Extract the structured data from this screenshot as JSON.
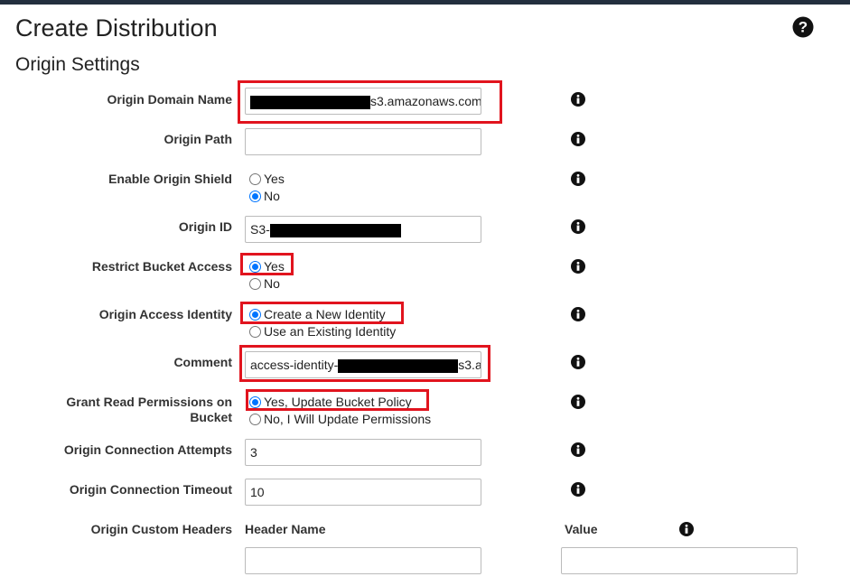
{
  "page": {
    "title": "Create Distribution",
    "section_title": "Origin Settings"
  },
  "fields": {
    "origin_domain_name": {
      "label": "Origin Domain Name",
      "value_suffix": "s3.amazonaws.com"
    },
    "origin_path": {
      "label": "Origin Path",
      "value": ""
    },
    "enable_origin_shield": {
      "label": "Enable Origin Shield",
      "options": [
        "Yes",
        "No"
      ],
      "selected": "No"
    },
    "origin_id": {
      "label": "Origin ID",
      "value_prefix": "S3-"
    },
    "restrict_bucket_access": {
      "label": "Restrict Bucket Access",
      "options": [
        "Yes",
        "No"
      ],
      "selected": "Yes"
    },
    "origin_access_identity": {
      "label": "Origin Access Identity",
      "options": [
        "Create a New Identity",
        "Use an Existing Identity"
      ],
      "selected": "Create a New Identity"
    },
    "comment": {
      "label": "Comment",
      "value_prefix": "access-identity-",
      "value_suffix": "s3.a"
    },
    "grant_read_permissions": {
      "label_line1": "Grant Read Permissions on",
      "label_line2": "Bucket",
      "options": [
        "Yes, Update Bucket Policy",
        "No, I Will Update Permissions"
      ],
      "selected": "Yes, Update Bucket Policy"
    },
    "origin_connection_attempts": {
      "label": "Origin Connection Attempts",
      "value": "3"
    },
    "origin_connection_timeout": {
      "label": "Origin Connection Timeout",
      "value": "10"
    },
    "origin_custom_headers": {
      "label": "Origin Custom Headers",
      "header_name_label": "Header Name",
      "value_label": "Value",
      "header_name_value": "",
      "value_value": ""
    }
  },
  "icons": {
    "help": "question-circle-icon",
    "info": "info-circle-icon"
  },
  "colors": {
    "highlight": "#e1141e",
    "radio_accent": "#0075ff",
    "topbar": "#232f3e"
  }
}
